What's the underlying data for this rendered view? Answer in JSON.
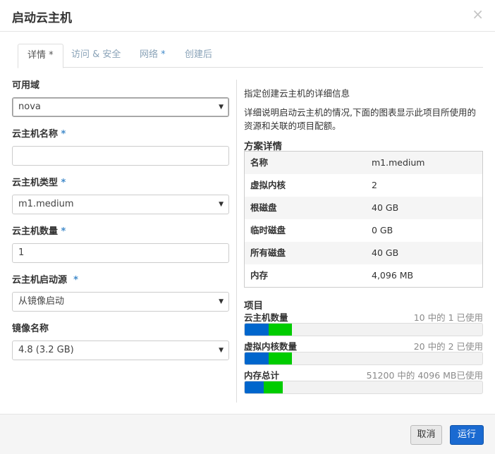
{
  "dialog": {
    "title": "启动云主机",
    "close_glyph": "×"
  },
  "tabs": [
    {
      "label": "详情",
      "required_mark": "*"
    },
    {
      "label": "访问 & 安全",
      "required_mark": ""
    },
    {
      "label": "网络",
      "required_mark": "*"
    },
    {
      "label": "创建后",
      "required_mark": ""
    }
  ],
  "form": {
    "availability_zone": {
      "label": "可用域",
      "value": "nova"
    },
    "instance_name": {
      "label": "云主机名称",
      "required_mark": "*",
      "value": ""
    },
    "flavor": {
      "label": "云主机类型",
      "required_mark": "*",
      "value": "m1.medium"
    },
    "instance_count": {
      "label": "云主机数量",
      "required_mark": "*",
      "value": "1"
    },
    "boot_source": {
      "label": "云主机启动源",
      "required_mark": "*",
      "value": "从镜像启动"
    },
    "image_name": {
      "label": "镜像名称",
      "value": "4.8 (3.2 GB)"
    }
  },
  "info": {
    "intro": "指定创建云主机的详细信息",
    "description": "详细说明启动云主机的情况,下面的图表显示此项目所使用的资源和关联的项目配额。",
    "flavor_details_title": "方案详情",
    "flavor_details": [
      {
        "key": "名称",
        "value": "m1.medium"
      },
      {
        "key": "虚拟内核",
        "value": "2"
      },
      {
        "key": "根磁盘",
        "value": "40 GB"
      },
      {
        "key": "临时磁盘",
        "value": "0 GB"
      },
      {
        "key": "所有磁盘",
        "value": "40 GB"
      },
      {
        "key": "内存",
        "value": "4,096 MB"
      }
    ],
    "project_limits_title": "项目",
    "quotas": [
      {
        "label": "云主机数量",
        "usage_text": "10 中的 1 已使用",
        "used_fraction": 0.1,
        "added_fraction": 0.1
      },
      {
        "label": "虚拟内核数量",
        "usage_text": "20 中的 2 已使用",
        "used_fraction": 0.1,
        "added_fraction": 0.1
      },
      {
        "label": "内存总计",
        "usage_text": "51200 中的 4096 MB已使用",
        "used_fraction": 0.08,
        "added_fraction": 0.08
      }
    ],
    "colors": {
      "used": "#0066cc",
      "added": "#00cc00"
    }
  },
  "footer": {
    "cancel_label": "取消",
    "launch_label": "运行"
  }
}
